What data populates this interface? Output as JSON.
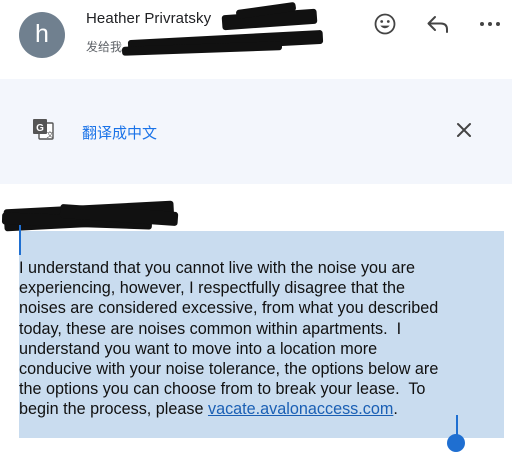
{
  "header": {
    "avatar_letter": "h",
    "sender_name": "Heather Privratsky",
    "recipient_prefix": "发给我"
  },
  "actions": {
    "emoji_icon": "smiley-icon",
    "reply_icon": "reply-arrow-icon",
    "more_icon": "more-dots-icon"
  },
  "translate": {
    "icon": "google-translate-icon",
    "label": "翻译成中文",
    "close_icon": "close-icon"
  },
  "message": {
    "lines": [
      "I understand that you cannot live with the noise you are",
      "experiencing, however, I respectfully disagree that the",
      "noises are considered excessive, from what you described",
      "today, these are noises common within apartments.  I",
      "understand you want to move into a location more",
      "conducive with your noise tolerance, the options below are",
      "the options you can choose from to break your lease.  To"
    ],
    "last_line_prefix": "begin the process, please ",
    "link_text": "vacate.avalonaccess.com",
    "last_line_suffix": "."
  },
  "colors": {
    "avatar": "#70808f",
    "link": "#1a73e8",
    "selection": "#c9dcef",
    "selection_handle": "#1f6fd1",
    "translate_bar": "#f3f6fc"
  }
}
